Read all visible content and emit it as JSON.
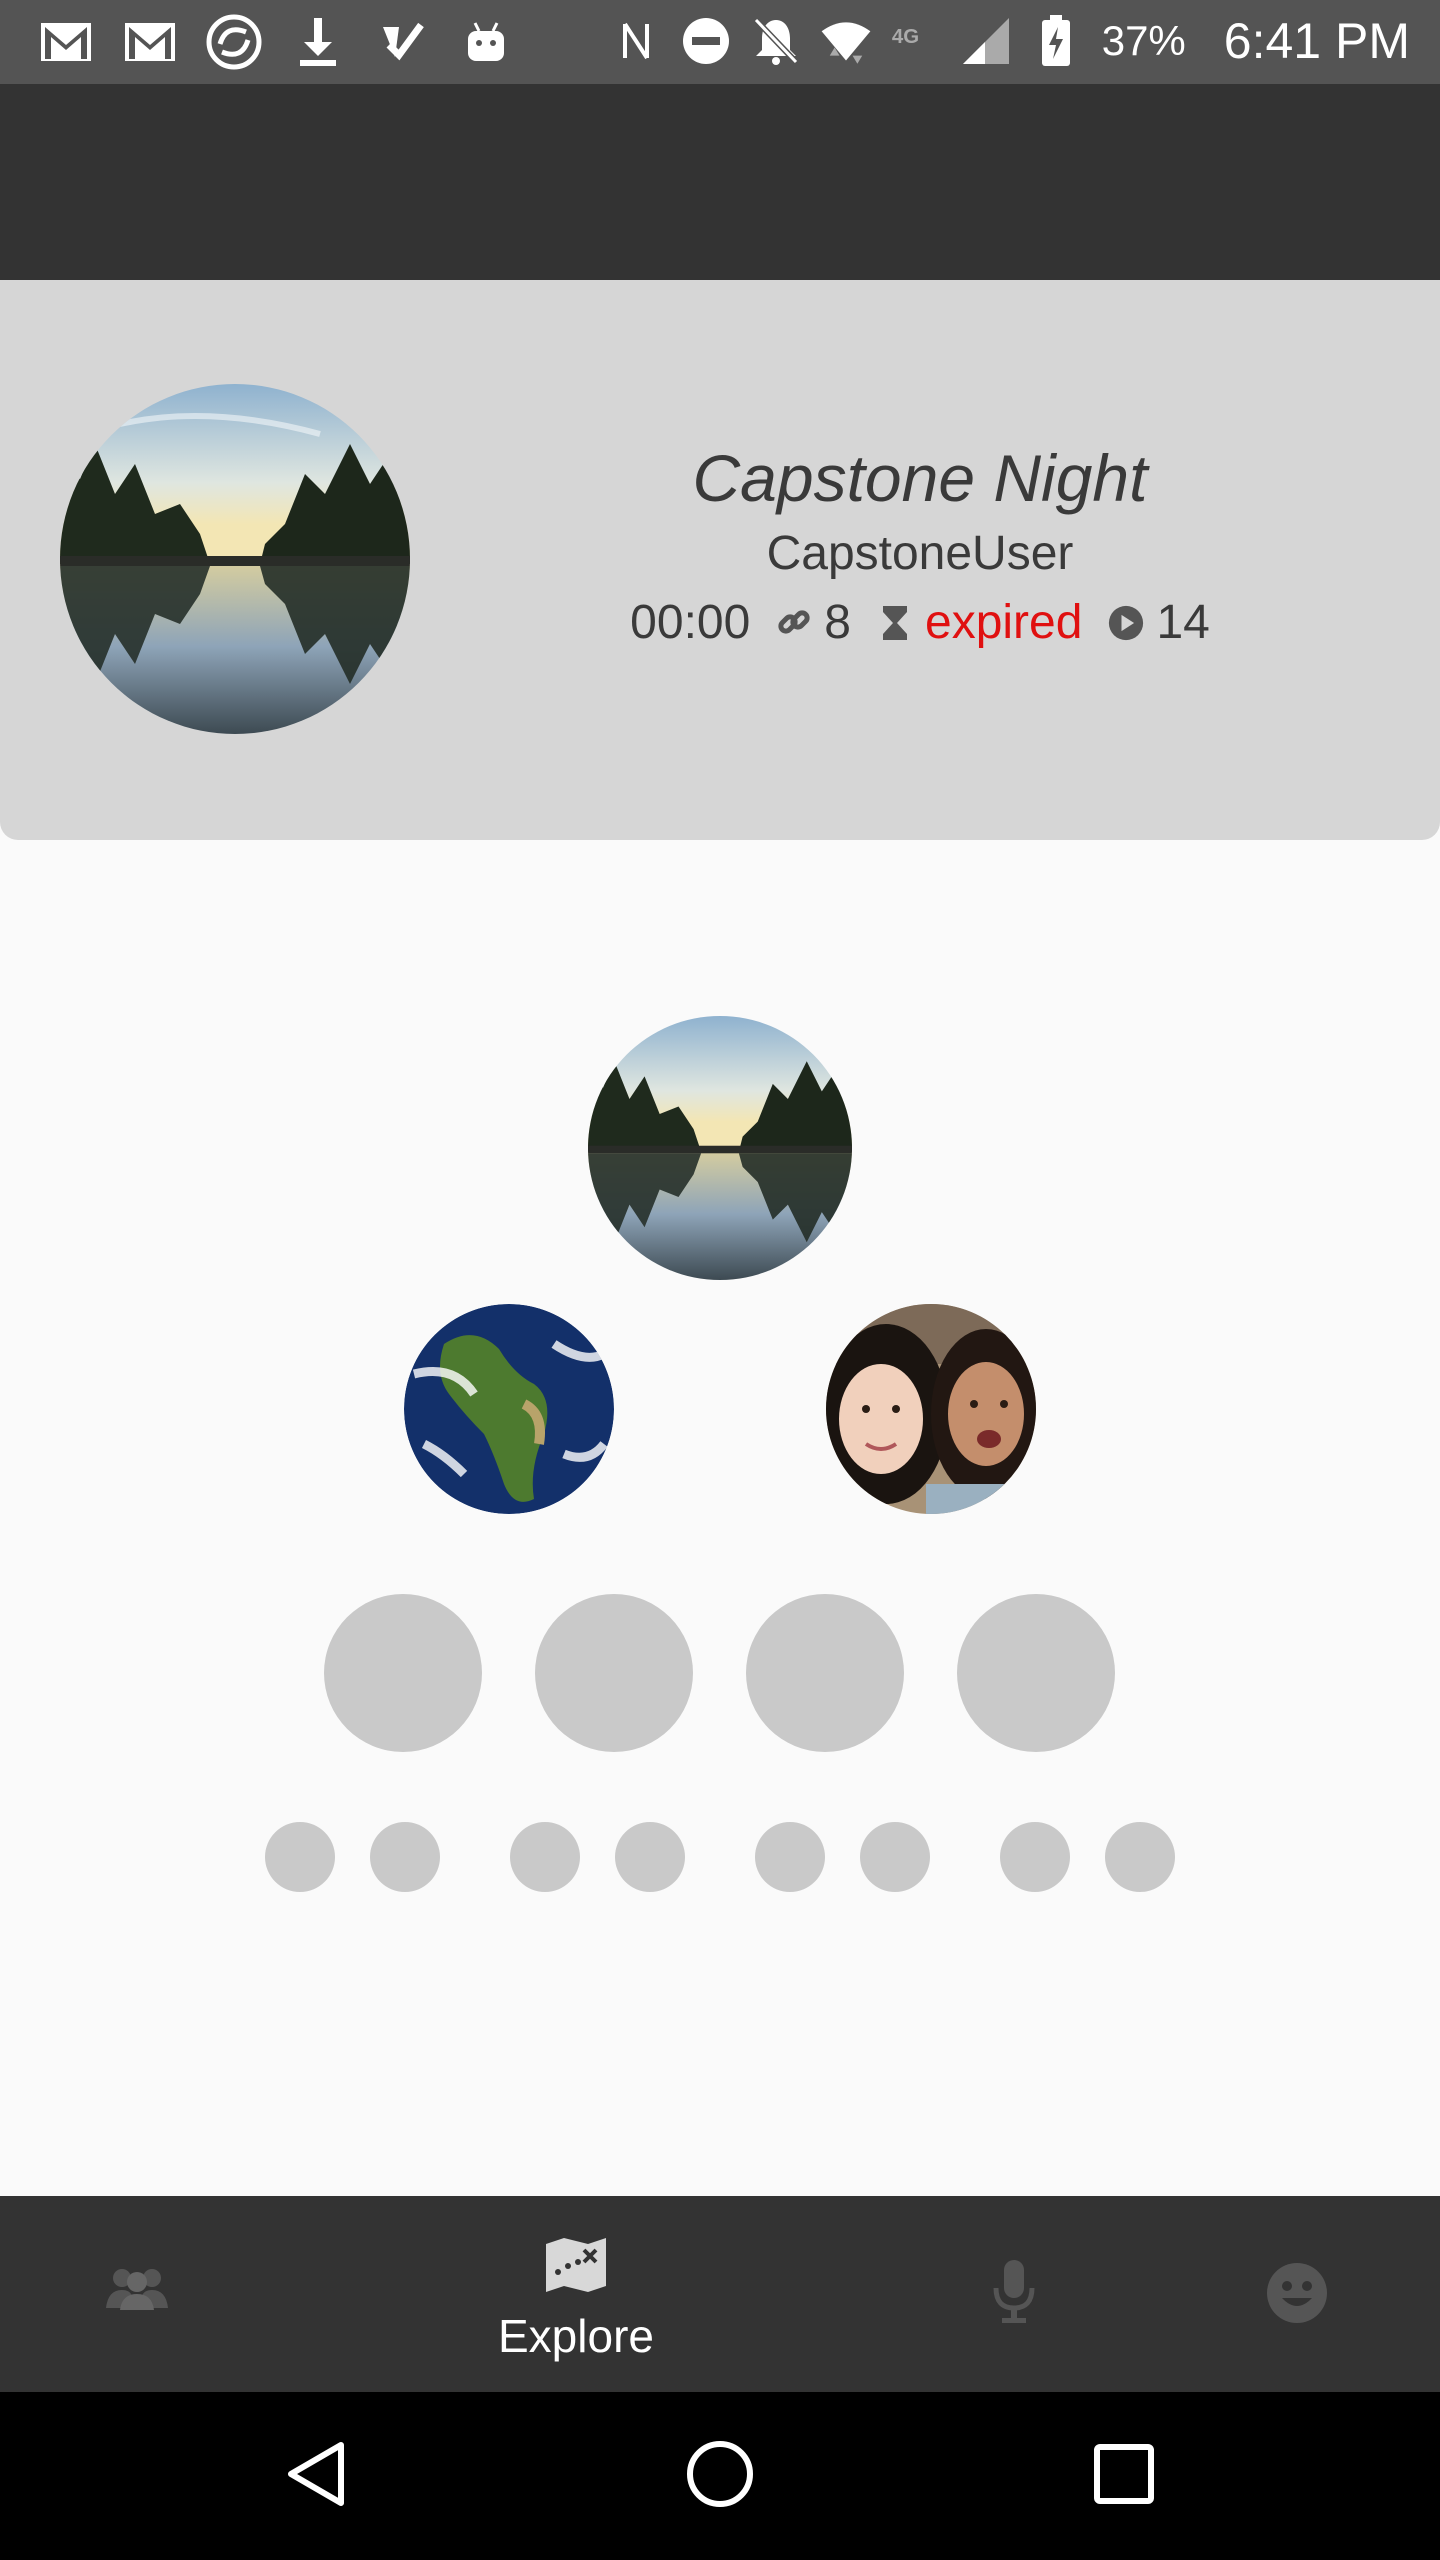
{
  "status_bar": {
    "battery": "37%",
    "time": "6:41 PM",
    "left_icons": [
      "gmail-icon",
      "gmail-icon",
      "sync-app-icon",
      "download-icon",
      "check-app-icon",
      "android-icon"
    ],
    "right_icons": [
      "nfc-icon",
      "do-not-disturb-icon",
      "notifications-off-icon",
      "wifi-icon",
      "4g-lte-icon",
      "cell-signal-icon",
      "battery-charging-icon"
    ]
  },
  "story": {
    "title": "Capstone Night",
    "user": "CapstoneUser",
    "duration": "00:00",
    "links": "8",
    "status": "expired",
    "plays": "14"
  },
  "colors": {
    "expired": "#e01010",
    "app_bar": "#333333",
    "header_bg": "#d6d6d6",
    "placeholder": "#c9c9c9"
  },
  "bottom_nav": {
    "items": [
      {
        "icon": "people-icon",
        "label": ""
      },
      {
        "icon": "explore-map-icon",
        "label": "Explore"
      },
      {
        "icon": "microphone-icon",
        "label": ""
      },
      {
        "icon": "smiley-icon",
        "label": ""
      }
    ]
  },
  "system_nav": [
    "back-icon",
    "home-icon",
    "recents-icon"
  ]
}
